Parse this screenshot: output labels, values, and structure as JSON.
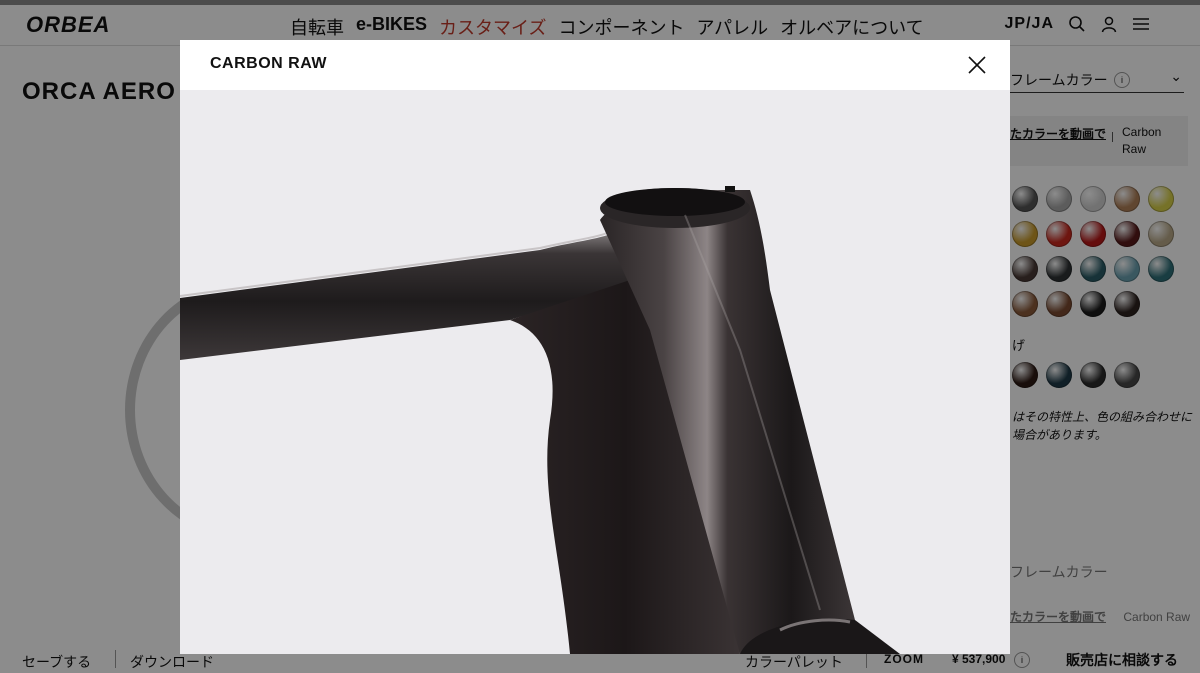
{
  "header": {
    "logo": "ORBEA",
    "nav": [
      "自転車",
      "e-BIKES",
      "カスタマイズ",
      "コンポーネント",
      "アパレル",
      "オルベアについて"
    ],
    "active_nav": "カスタマイズ",
    "lang": "JP/JA"
  },
  "model": {
    "title": "ORCA AERO OMX"
  },
  "options": {
    "frame_color_label": "フレームカラー",
    "video_link": "たカラーを動画で",
    "selected_color": "Carbon Raw",
    "finish_label": "げ",
    "note": "はその特性上、色の組み合わせに場合があります。",
    "frame_color_label_2": "フレームカラー",
    "video_link_2": "たカラーを動画で",
    "selected_color_2": "Carbon Raw"
  },
  "swatch_colors": {
    "row1": [
      "#555555",
      "#a8a8a8",
      "#cfcfcf",
      "#b08058",
      "#d8d04a"
    ],
    "row2": [
      "#c89a2a",
      "#c8281e",
      "#b81818",
      "#5a1a1a",
      "#b8a888"
    ],
    "row3": [
      "#4a3a36",
      "#2e3234",
      "#2a5c66",
      "#6aa0b0",
      "#2f6f78"
    ],
    "row4": [
      "#8a5a3a",
      "#7a4a30",
      "#1c1c1c",
      "#2e2320"
    ],
    "row5": [
      "#2e1a14",
      "#1e3a48",
      "#2a2a2a",
      "#484848"
    ]
  },
  "footer": {
    "save": "セーブする",
    "download": "ダウンロード",
    "palette": "カラーパレット",
    "zoom": "ZOOM",
    "price": "¥ 537,900",
    "dealer": "販売店に相談する"
  },
  "modal": {
    "title": "CARBON RAW",
    "close_icon": "close-icon",
    "image_subject": "frame-closeup"
  }
}
